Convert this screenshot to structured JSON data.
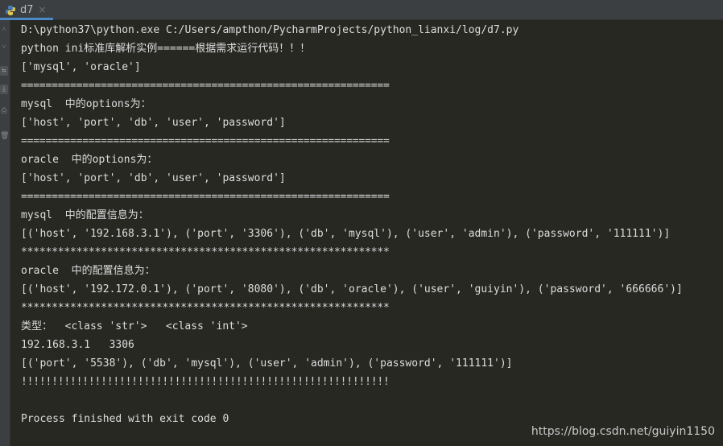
{
  "tab": {
    "icon": "python-file-icon",
    "label": "d7",
    "close_symbol": "×",
    "accent_color": "#4a88c7"
  },
  "gutter": {
    "icons": [
      {
        "name": "scroll-up-icon",
        "glyph": "˄"
      },
      {
        "name": "scroll-down-icon",
        "glyph": "˅"
      },
      {
        "name": "soft-wrap-icon",
        "glyph": "⇆"
      },
      {
        "name": "scroll-to-end-icon",
        "glyph": "⤓"
      },
      {
        "name": "print-icon",
        "glyph": "⎙"
      },
      {
        "name": "clear-icon",
        "glyph": "🗑"
      }
    ]
  },
  "console": {
    "lines": [
      "D:\\python37\\python.exe C:/Users/ampthon/PycharmProjects/python_lianxi/log/d7.py",
      "python ini标准库解析实例======根据需求运行代码！！！",
      "['mysql', 'oracle']",
      "============================================================",
      "mysql  中的options为：",
      "['host', 'port', 'db', 'user', 'password']",
      "============================================================",
      "oracle  中的options为：",
      "['host', 'port', 'db', 'user', 'password']",
      "============================================================",
      "mysql  中的配置信息为：",
      "[('host', '192.168.3.1'), ('port', '3306'), ('db', 'mysql'), ('user', 'admin'), ('password', '111111')]",
      "************************************************************",
      "oracle  中的配置信息为：",
      "[('host', '192.172.0.1'), ('port', '8080'), ('db', 'oracle'), ('user', 'guiyin'), ('password', '666666')]",
      "************************************************************",
      "类型：  <class 'str'>   <class 'int'>",
      "192.168.3.1   3306",
      "[('port', '5538'), ('db', 'mysql'), ('user', 'admin'), ('password', '111111')]",
      "!!!!!!!!!!!!!!!!!!!!!!!!!!!!!!!!!!!!!!!!!!!!!!!!!!!!!!!!!!!!",
      "",
      "Process finished with exit code 0"
    ]
  },
  "watermark": "https://blog.csdn.net/guiyin1150"
}
